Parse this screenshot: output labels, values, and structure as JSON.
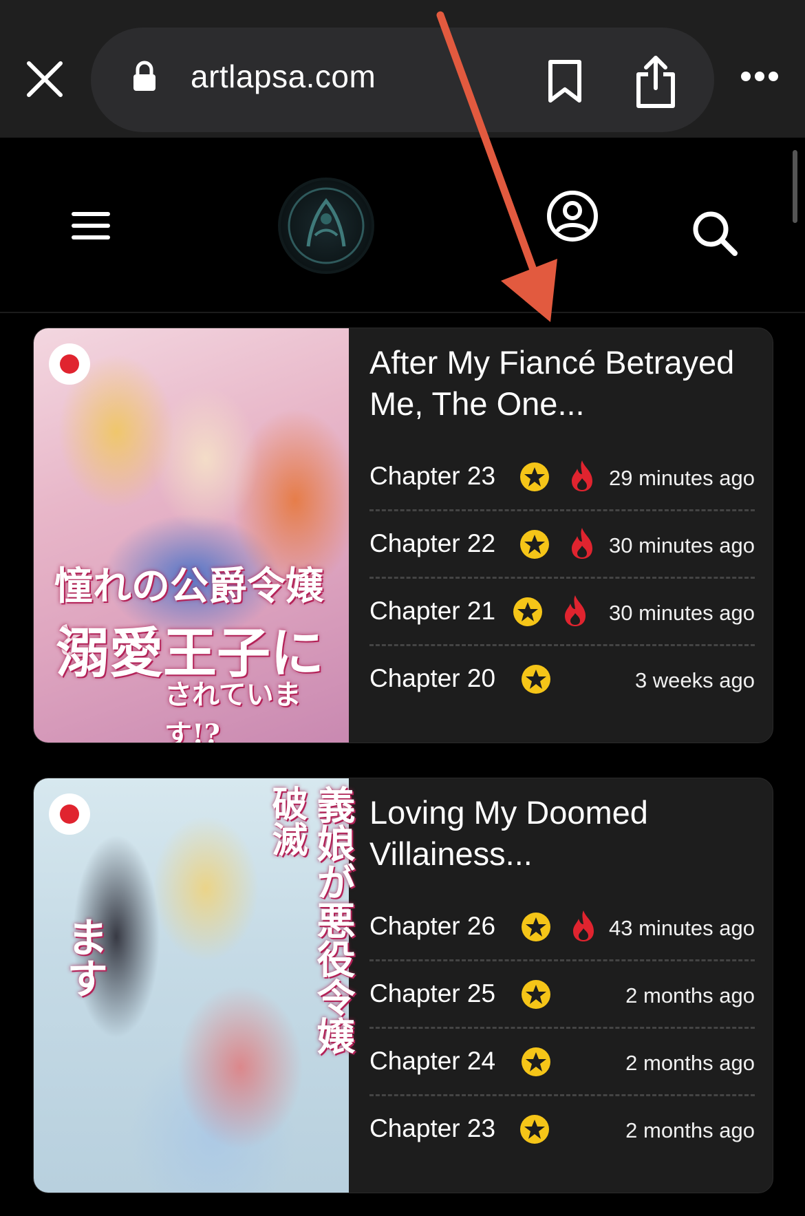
{
  "browser": {
    "url": "artlapsa.com"
  },
  "cards": [
    {
      "title": "After My Fiancé Betrayed Me, The One...",
      "cover_text": [
        "憧れの公爵令嬢と",
        "溺愛王子に",
        "されています!?"
      ],
      "chapters": [
        {
          "label": "Chapter 23",
          "time": "29 minutes ago",
          "hot": true
        },
        {
          "label": "Chapter 22",
          "time": "30 minutes ago",
          "hot": true
        },
        {
          "label": "Chapter 21",
          "time": "30 minutes ago",
          "hot": true
        },
        {
          "label": "Chapter 20",
          "time": "3 weeks ago",
          "hot": false
        }
      ]
    },
    {
      "title": "Loving My Doomed Villainess...",
      "cover_text": [
        "義娘が悪役令嬢",
        "破滅",
        "ます"
      ],
      "chapters": [
        {
          "label": "Chapter 26",
          "time": "43 minutes ago",
          "hot": true
        },
        {
          "label": "Chapter 25",
          "time": "2 months ago",
          "hot": false
        },
        {
          "label": "Chapter 24",
          "time": "2 months ago",
          "hot": false
        },
        {
          "label": "Chapter 23",
          "time": "2 months ago",
          "hot": false
        }
      ]
    }
  ],
  "colors": {
    "star": "#f5c518",
    "fire": "#e0242f",
    "arrow": "#e25a3f"
  }
}
